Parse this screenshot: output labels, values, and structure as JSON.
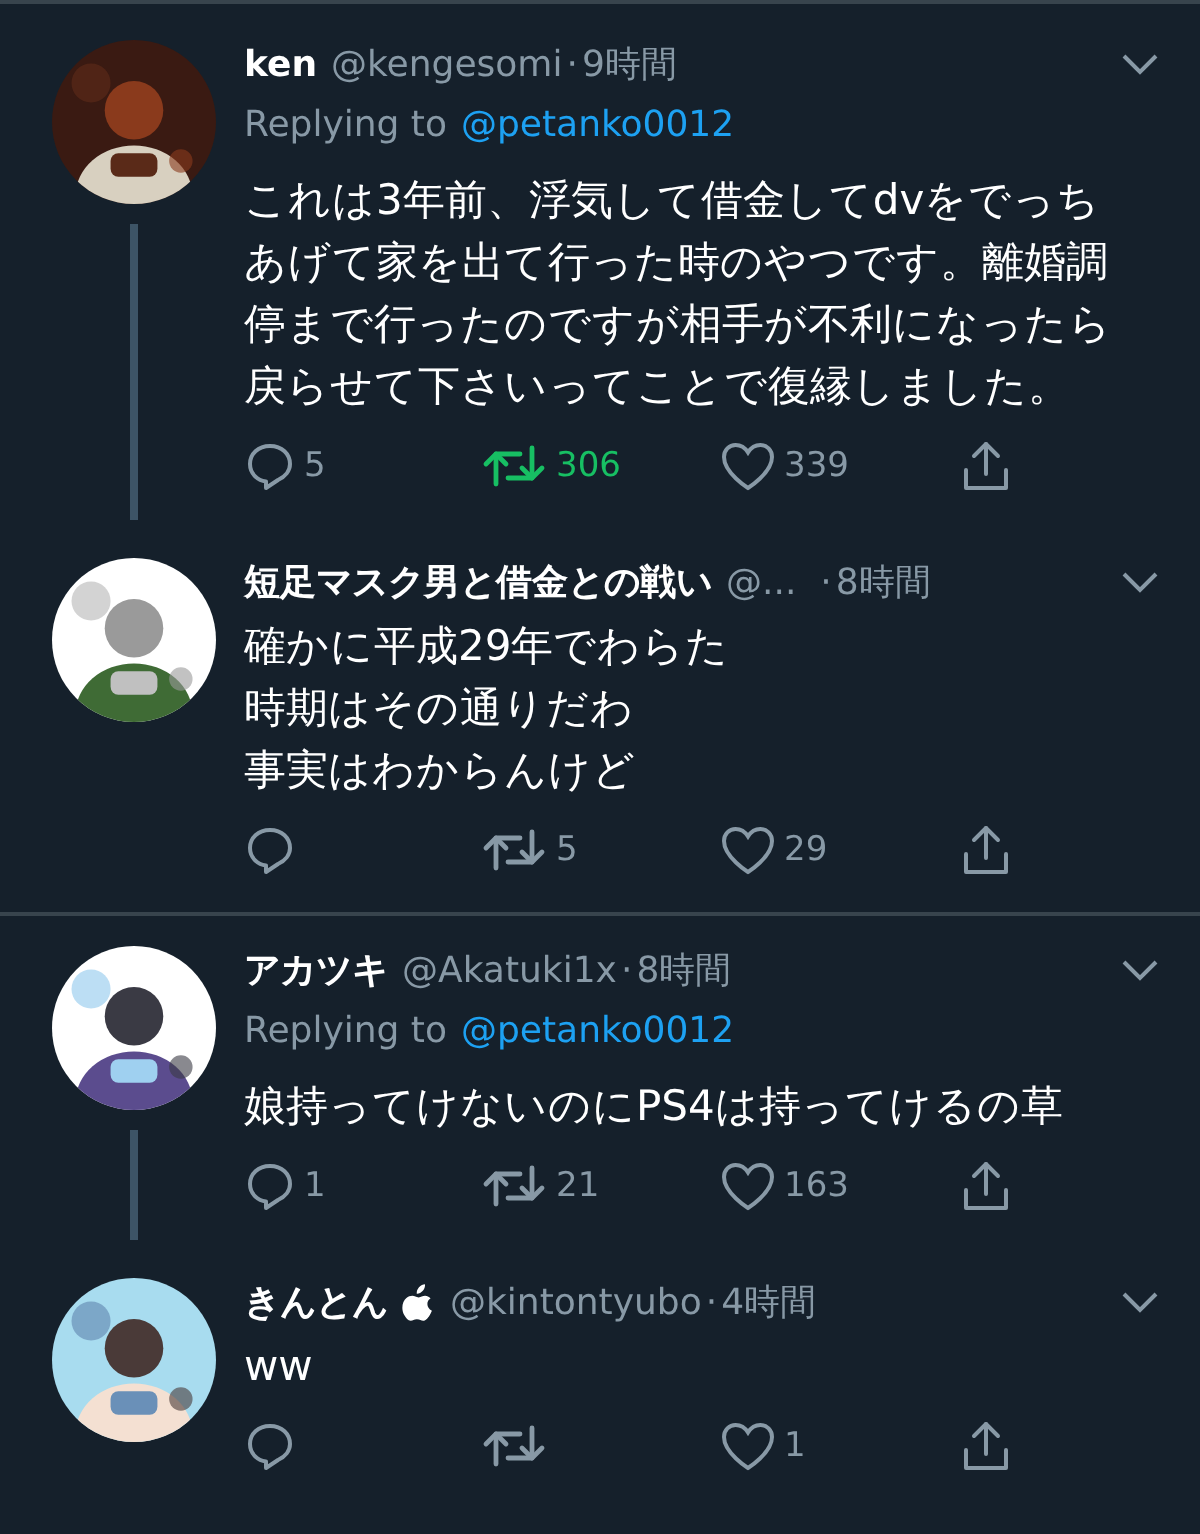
{
  "threads": [
    {
      "tweets": [
        {
          "name": "ken",
          "verified_apple": false,
          "handle": "@kengesomi",
          "separator": "·",
          "time": "9時間",
          "replying_to_label": "Replying to",
          "replying_to": "@petanko0012",
          "text": "これは3年前、浮気して借金してdvをでっちあげて家を出て行った時のやつです。離婚調停まで行ったのですが相手が不利になったら戻らせて下さいってことで復縁しました。",
          "thread_line": true,
          "replies": "5",
          "retweets": "306",
          "retweeted": true,
          "likes": "339",
          "liked": false
        },
        {
          "name": "短足マスク男と借金との戦い",
          "verified_apple": false,
          "handle": "@...",
          "separator": "·",
          "time": "8時間",
          "text_lines": [
            "確かに平成29年でわらた",
            "時期はその通りだわ",
            "事実はわからんけど"
          ],
          "thread_line": false,
          "retweets": "5",
          "retweeted": false,
          "likes": "29",
          "liked": false
        }
      ]
    },
    {
      "tweets": [
        {
          "name": "アカツキ",
          "verified_apple": false,
          "handle": "@Akatuki1x",
          "separator": "·",
          "time": "8時間",
          "replying_to_label": "Replying to",
          "replying_to": "@petanko0012",
          "text": "娘持ってけないのにPS4は持ってけるの草",
          "thread_line": true,
          "replies": "1",
          "retweets": "21",
          "retweeted": false,
          "likes": "163",
          "liked": false
        },
        {
          "name": "きんとん",
          "verified_apple": true,
          "handle": "@kintontyubo",
          "separator": "·",
          "time": "4時間",
          "text": "ww",
          "thread_line": false,
          "retweeted": false,
          "likes": "1",
          "liked": false
        }
      ]
    }
  ]
}
